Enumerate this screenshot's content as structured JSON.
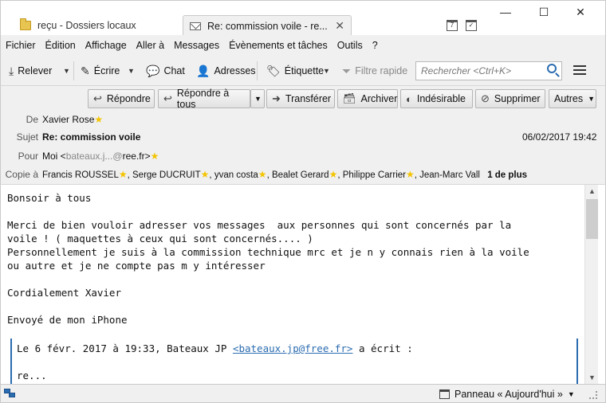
{
  "tabs": [
    {
      "label": "reçu - Dossiers locaux"
    },
    {
      "label": "Re: commission voile - re...",
      "close": "✕"
    }
  ],
  "window_controls": {
    "minimize": "—",
    "maximize": "☐",
    "close": "✕"
  },
  "calendar_day": "7",
  "menu": [
    "Fichier",
    "Édition",
    "Affichage",
    "Aller à",
    "Messages",
    "Évènements et tâches",
    "Outils",
    "?"
  ],
  "toolbar": {
    "relever": "Relever",
    "ecrire": "Écrire",
    "chat": "Chat",
    "adresses": "Adresses",
    "etiquette": "Étiquette",
    "filtre_rapide": "Filtre rapide",
    "search_placeholder": "Rechercher <Ctrl+K>"
  },
  "actions": {
    "repondre": "Répondre",
    "repondre_tous": "Répondre à tous",
    "transferer": "Transférer",
    "archiver": "Archiver",
    "indesirable": "Indésirable",
    "supprimer": "Supprimer",
    "autres": "Autres"
  },
  "header": {
    "from_label": "De",
    "from": "Xavier Rose",
    "subject_label": "Sujet",
    "subject": "Re: commission voile",
    "date": "06/02/2017 19:42",
    "to_label": "Pour",
    "to_prefix": "Moi <",
    "to_masked": "bateaux.j...@",
    "to_suffix": "ree.fr>",
    "cc_label": "Copie à",
    "cc": [
      "Francis ROUSSEL",
      "Serge DUCRUIT",
      "yvan costa",
      "Bealet Gerard",
      "Philippe Carrier",
      "Jean-Marc Vall"
    ],
    "cc_more": "1 de plus"
  },
  "body": {
    "greeting": "Bonsoir à tous",
    "para1": "Merci de bien vouloir adresser vos messages  aux personnes qui sont concernés par la\nvoile ! ( maquettes à ceux qui sont concernés.... )\nPersonnellement je suis à la commission technique mrc et je n y connais rien à la voile\nou autre et je ne compte pas m y intéresser",
    "signoff": "Cordialement Xavier",
    "sent_from": "Envoyé de mon iPhone",
    "quote_intro": "Le 6 févr. 2017 à 19:33, Bateaux JP",
    "quote_link": "<bateaux.jp@free.fr>",
    "quote_suffix": "a écrit :",
    "quote_text": "re..."
  },
  "status": {
    "today_pane": "Panneau « Aujourd'hui »"
  },
  "colors": {
    "accent": "#2b6cb0",
    "star": "#f3c400",
    "chrome": "#f0f0f0"
  }
}
